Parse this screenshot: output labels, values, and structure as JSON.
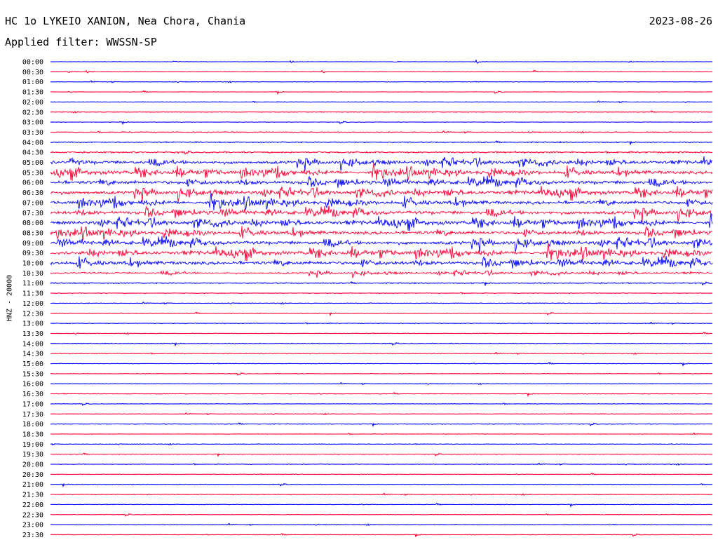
{
  "header": {
    "station": "HC 1o LYKEIO XANION, Nea Chora, Chania",
    "date": "2023-08-26",
    "filter": "Applied filter: WWSSN-SP"
  },
  "chart_data": {
    "type": "line",
    "title": "HC 1o LYKEIO XANION, Nea Chora, Chania",
    "ylabel": "HNZ - 20000",
    "rows": [
      "00:00",
      "00:30",
      "01:00",
      "01:30",
      "02:00",
      "02:30",
      "03:00",
      "03:30",
      "04:00",
      "04:30",
      "05:00",
      "05:30",
      "06:00",
      "06:30",
      "07:00",
      "07:30",
      "08:00",
      "08:30",
      "09:00",
      "09:30",
      "10:00",
      "10:30",
      "11:00",
      "11:30",
      "12:00",
      "12:30",
      "13:00",
      "13:30",
      "14:00",
      "14:30",
      "15:00",
      "15:30",
      "16:00",
      "16:30",
      "17:00",
      "17:30",
      "18:00",
      "18:30",
      "19:00",
      "19:30",
      "20:00",
      "20:30",
      "21:00",
      "21:30",
      "22:00",
      "22:30",
      "23:00",
      "23:30"
    ],
    "row_duration_minutes": 30,
    "series_colors": [
      "#0000ff",
      "#ff0033"
    ],
    "activity": [
      0.05,
      0.05,
      0.05,
      0.05,
      0.06,
      0.06,
      0.06,
      0.1,
      0.12,
      0.18,
      0.9,
      1.0,
      1.0,
      1.0,
      1.0,
      1.0,
      1.0,
      1.0,
      1.0,
      1.0,
      1.0,
      0.5,
      0.12,
      0.08,
      0.07,
      0.06,
      0.08,
      0.06,
      0.08,
      0.07,
      0.06,
      0.06,
      0.06,
      0.07,
      0.06,
      0.06,
      0.08,
      0.06,
      0.06,
      0.06,
      0.07,
      0.06,
      0.06,
      0.08,
      0.06,
      0.06,
      0.07,
      0.06
    ],
    "grid": false
  }
}
